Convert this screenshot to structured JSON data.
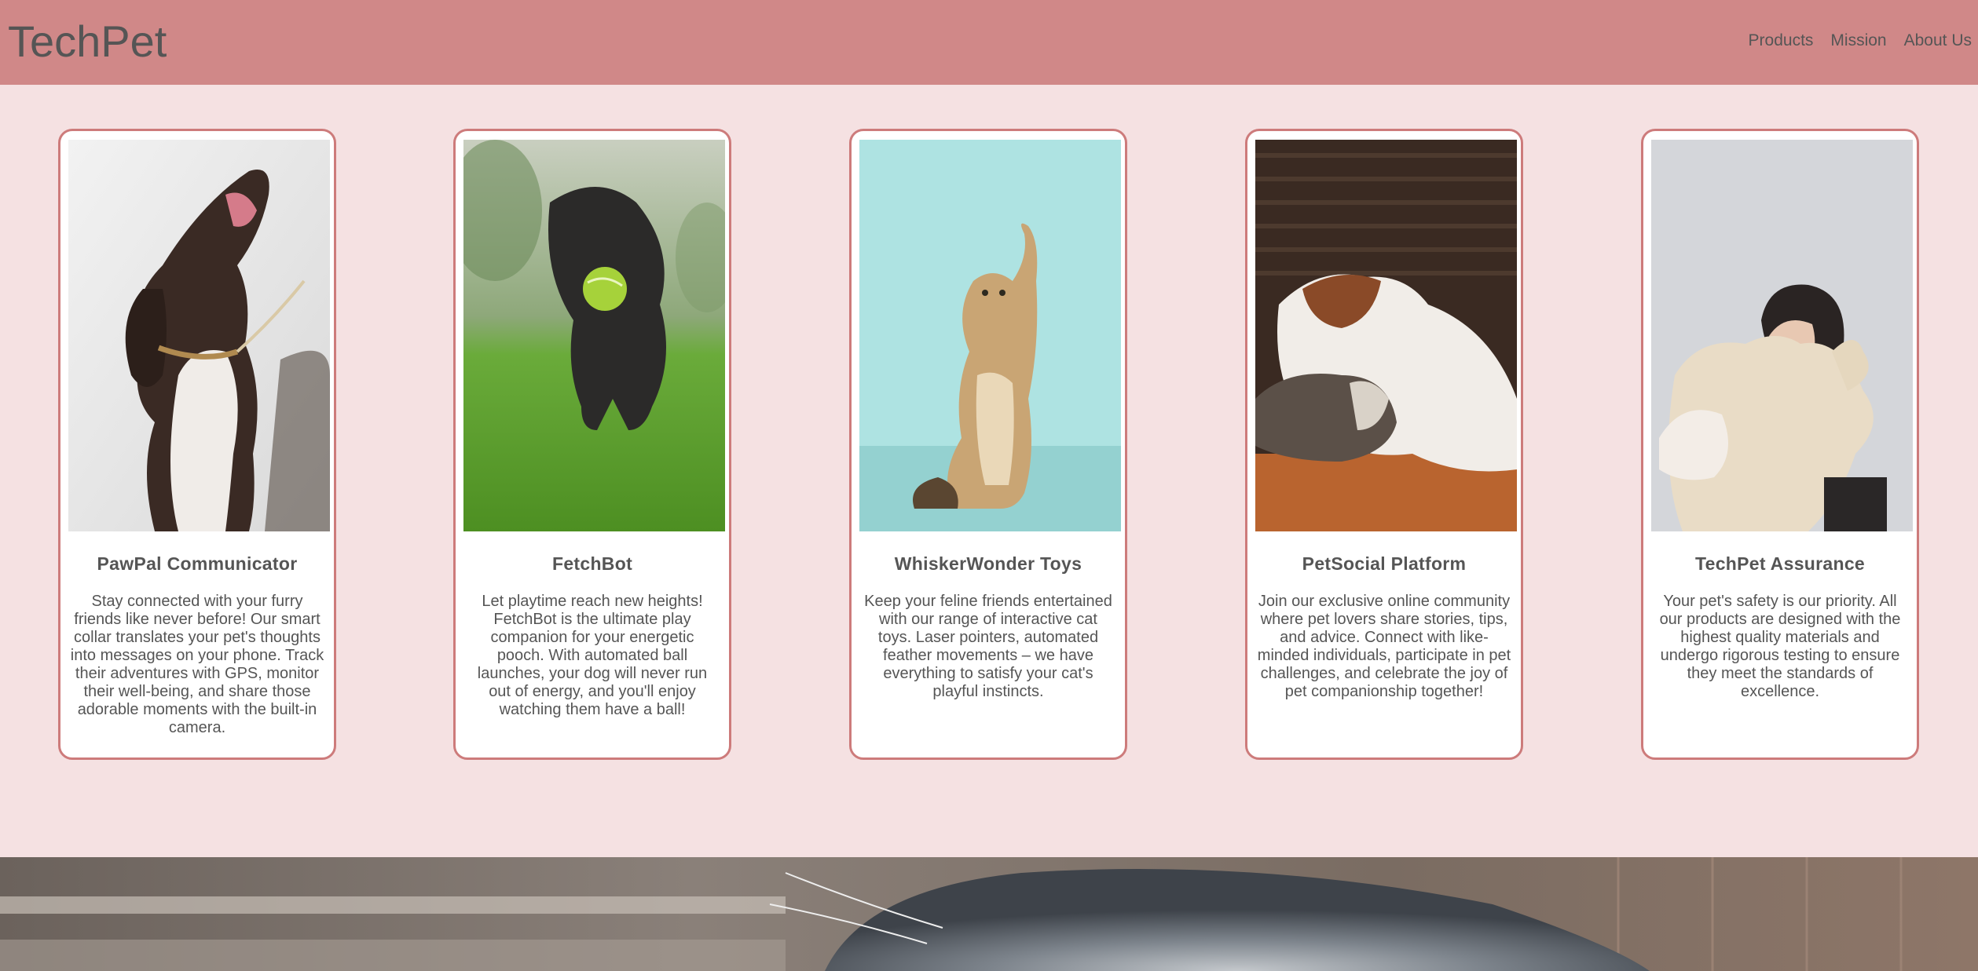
{
  "header": {
    "brand": "TechPet",
    "nav": [
      "Products",
      "Mission",
      "About Us"
    ]
  },
  "colors": {
    "header_bg": "#d08888",
    "page_bg": "#f5e1e2",
    "card_border": "#cd7b7b",
    "text": "#555555"
  },
  "cards": [
    {
      "title": "PawPal Communicator",
      "description": "Stay connected with your furry friends like never before! Our smart collar translates your pet's thoughts into messages on your phone. Track their adventures with GPS, monitor their well-being, and share those adorable moments with the built-in camera.",
      "image": "spaniel-dog-photo"
    },
    {
      "title": "FetchBot",
      "description": "Let playtime reach new heights! FetchBot is the ultimate play companion for your energetic pooch. With automated ball launches, your dog will never run out of energy, and you'll enjoy watching them have a ball!",
      "image": "dog-with-tennis-ball-photo"
    },
    {
      "title": "WhiskerWonder Toys",
      "description": "Keep your feline friends entertained with our range of interactive cat toys. Laser pointers, automated feather movements – we have everything to satisfy your cat's playful instincts.",
      "image": "kitten-reaching-photo"
    },
    {
      "title": "PetSocial Platform",
      "description": "Join our exclusive online community where pet lovers share stories, tips, and advice. Connect with like-minded individuals, participate in pet challenges, and celebrate the joy of pet companionship together!",
      "image": "dog-and-cat-photo"
    },
    {
      "title": "TechPet Assurance",
      "description": "Your pet's safety is our priority. All our products are designed with the highest quality materials and undergo rigorous testing to ensure they meet the standards of excellence.",
      "image": "woman-hugging-dog-photo"
    }
  ],
  "hero": {
    "image": "dog-closeup-banner-photo"
  }
}
